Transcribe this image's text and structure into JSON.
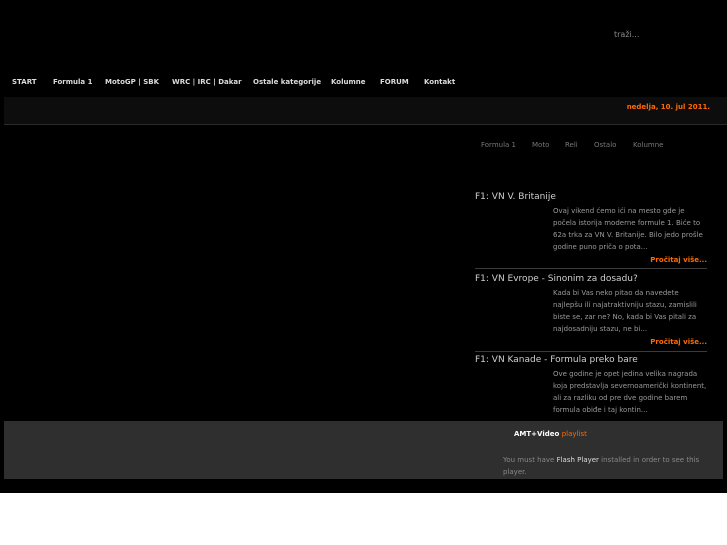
{
  "header": {
    "search_label": "traži..."
  },
  "nav": {
    "items": [
      "START",
      "Formula 1",
      "MotoGP | SBK",
      "WRC | IRC | Dakar",
      "Ostale kategorije",
      "Kolumne",
      "FORUM",
      "Kontakt"
    ]
  },
  "date": "nedelja, 10. jul 2011.",
  "tabs": [
    "Formula 1",
    "Moto",
    "Reli",
    "Ostalo",
    "Kolumne"
  ],
  "articles": [
    {
      "title": "F1: VN V. Britanije",
      "body": "Ovaj vikend ćemo ići na mesto gde je počela istorija moderne formule 1. Biće to 62a trka za VN V. Britanije. Bilo jedo prošle godine puno priča o pota...",
      "more": "Pročitaj više..."
    },
    {
      "title": "F1: VN Evrope - Sinonim za dosadu?",
      "body": "Kada bi Vas neko pitao da navedete najlepšu ili najatraktivniju stazu, zamislili biste se, zar ne? No, kada bi Vas pitali za najdosadniju stazu, ne bi...",
      "more": "Pročitaj više..."
    },
    {
      "title": "F1: VN Kanade - Formula preko bare",
      "body": "Ove godine je opet jedina velika nagrada koja predstavlja severnoamerički kontinent, ali za razliku od pre dve godine barem formula obiđe i taj kontin...",
      "more": ""
    }
  ],
  "player": {
    "title": "AMT+Video",
    "title_suffix": "playlist",
    "msg_prefix": "You must have",
    "msg_link": "Flash Player",
    "msg_suffix": "installed in order to see this player."
  },
  "colors": {
    "accent": "#ff6a00",
    "background": "#000000",
    "panel": "#2f2f2f"
  }
}
